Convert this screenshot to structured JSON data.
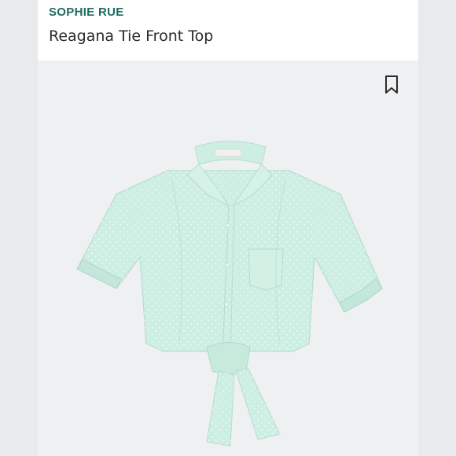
{
  "header": {
    "brand": "SOPHIE RUE",
    "product_title": "Reagana Tie Front Top"
  },
  "icons": {
    "bookmark": "bookmark-icon"
  },
  "image": {
    "subject": "product-photo",
    "shirt_color": "#cdeee2",
    "shirt_shade": "#b6ddcf",
    "dot_color": "#f4fbf8"
  },
  "colors": {
    "brand": "#1f6a63",
    "title": "#2b2b2b",
    "photo_bg": "#eff0f1"
  }
}
